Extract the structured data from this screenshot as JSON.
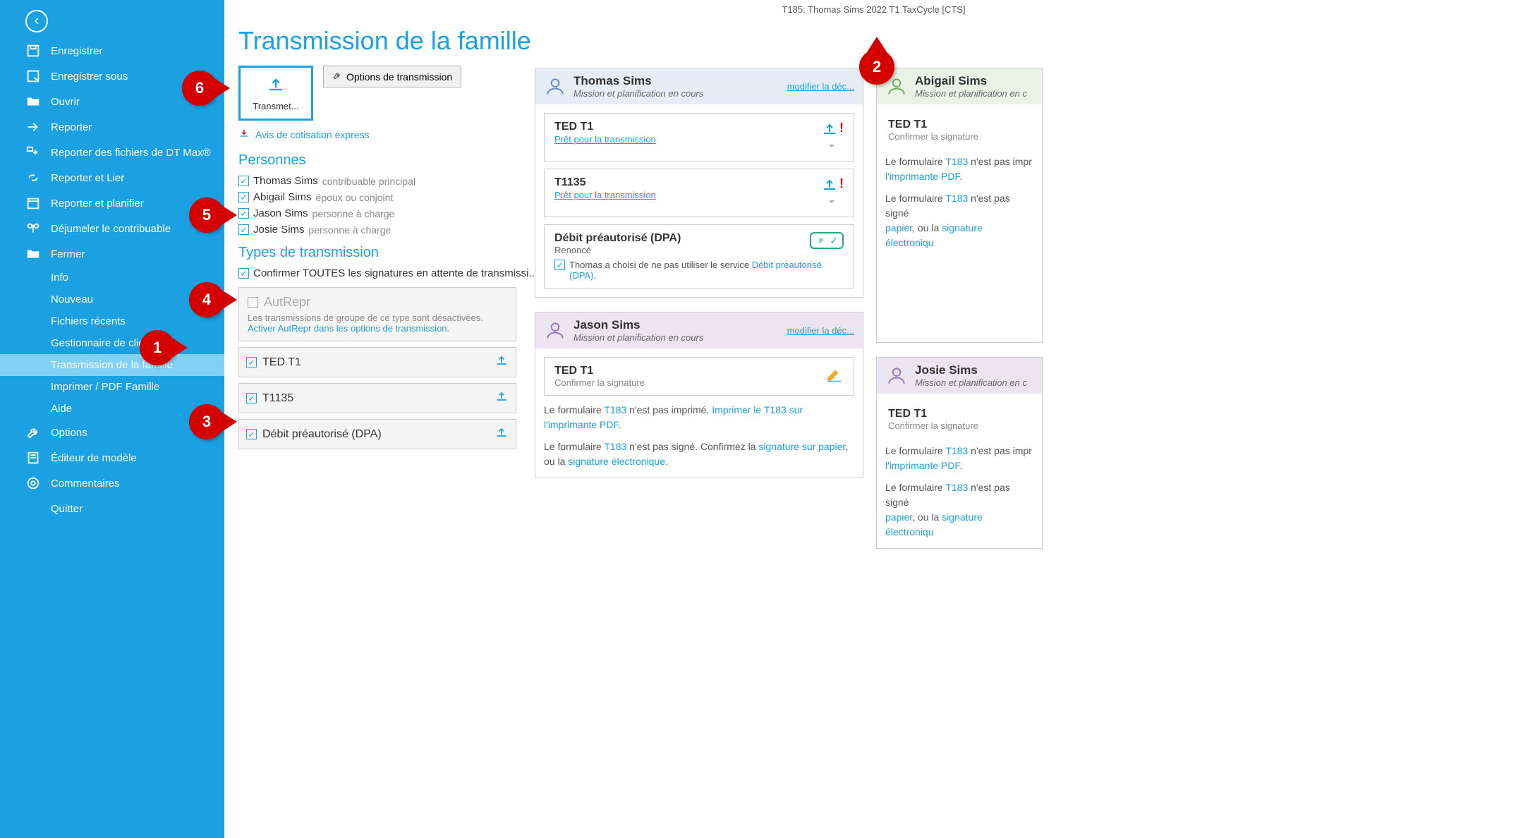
{
  "titlebar": "T185: Thomas Sims 2022 T1 TaxCycle [CTS]",
  "page_title": "Transmission de la famille",
  "sidebar": {
    "items": [
      {
        "label": "Enregistrer"
      },
      {
        "label": "Enregistrer sous"
      },
      {
        "label": "Ouvrir"
      },
      {
        "label": "Reporter"
      },
      {
        "label": "Reporter des fichiers de DT Max®"
      },
      {
        "label": "Reporter et Lier"
      },
      {
        "label": "Reporter et planifier"
      },
      {
        "label": "Déjumeler le contribuable"
      },
      {
        "label": "Fermer"
      },
      {
        "label": "Info"
      },
      {
        "label": "Nouveau"
      },
      {
        "label": "Fichiers récents"
      },
      {
        "label": "Gestionnaire de clients"
      },
      {
        "label": "Transmission de la famille"
      },
      {
        "label": "Imprimer / PDF Famille"
      },
      {
        "label": "Aide"
      },
      {
        "label": "Options"
      },
      {
        "label": "Éditeur de modèle"
      },
      {
        "label": "Commentaires"
      },
      {
        "label": "Quitter"
      }
    ]
  },
  "toolbar": {
    "transmit": "Transmet...",
    "options": "Options de transmission",
    "express_link": "Avis de cotisation express"
  },
  "persons_header": "Personnes",
  "persons": [
    {
      "name": "Thomas Sims",
      "role": "contribuable principal"
    },
    {
      "name": "Abigail Sims",
      "role": "époux ou conjoint"
    },
    {
      "name": "Jason Sims",
      "role": "personne à charge"
    },
    {
      "name": "Josie Sims",
      "role": "personne à charge"
    }
  ],
  "tx_header": "Types de transmission",
  "tx_confirm": "Confirmer TOUTES les signatures en attente de transmissi...",
  "autrepr": {
    "title": "AutRepr",
    "desc": "Les transmissions de groupe de ce type sont désactivées.",
    "link": "Activer AutRepr dans les options de transmission."
  },
  "tx_types": [
    {
      "label": "TED T1"
    },
    {
      "label": "T1135"
    },
    {
      "label": "Débit préautorisé (DPA)"
    }
  ],
  "cards": {
    "thomas": {
      "name": "Thomas Sims",
      "status": "Mission et planification en cours",
      "modify": "modifier la déc...",
      "ted": {
        "title": "TED T1",
        "link": "Prêt pour la transmission"
      },
      "t1135": {
        "title": "T1135",
        "link": "Prêt pour la transmission"
      },
      "dpa": {
        "title": "Débit préautorisé (DPA)",
        "sub": "Renoncé",
        "line_pre": "Thomas a choisi de ne pas utiliser le service ",
        "line_link": "Débit préautorisé (DPA)",
        "line_post": "."
      }
    },
    "abigail": {
      "name": "Abigail Sims",
      "status": "Mission et planification en c",
      "ted": {
        "title": "TED T1",
        "sub": "Confirmer la signature"
      },
      "note1_a": "Le formulaire ",
      "note1_link": "T183",
      "note1_b": " n'est pas impr",
      "note1_link2": "l'imprimante PDF",
      "note2_a": "Le formulaire ",
      "note2_b": " n'est pas signé",
      "note2_link_paper": "papier",
      "note2_mid": ", ou la ",
      "note2_link_sig": "signature électroniqu"
    },
    "jason": {
      "name": "Jason Sims",
      "status": "Mission et planification en cours",
      "modify": "modifier la déc...",
      "ted": {
        "title": "TED T1",
        "sub": "Confirmer la signature"
      },
      "note1_a": "Le formulaire ",
      "note1_link": "T183",
      "note1_b": " n'est pas imprimé. ",
      "note1_link2": "Imprimer le T183 sur l'imprimante PDF",
      "note1_c": ".",
      "note2_a": "Le formulaire ",
      "note2_b": " n'est pas signé. Confirmez la ",
      "note2_link_paper": "signature sur papier",
      "note2_mid": ", ou la ",
      "note2_link_sig": "signature électronique",
      "note2_c": "."
    },
    "josie": {
      "name": "Josie Sims",
      "status": "Mission et planification en c",
      "ted": {
        "title": "TED T1",
        "sub": "Confirmer la signature"
      },
      "note1_a": "Le formulaire ",
      "note1_link": "T183",
      "note1_b": " n'est pas impr",
      "note1_link2": "l'imprimante PDF",
      "note2_a": "Le formulaire ",
      "note2_b": " n'est pas signé",
      "note2_link_paper": "papier",
      "note2_mid": ", ou la ",
      "note2_link_sig": "signature électroniqu"
    }
  },
  "callouts": {
    "1": "1",
    "2": "2",
    "3": "3",
    "4": "4",
    "5": "5",
    "6": "6"
  }
}
